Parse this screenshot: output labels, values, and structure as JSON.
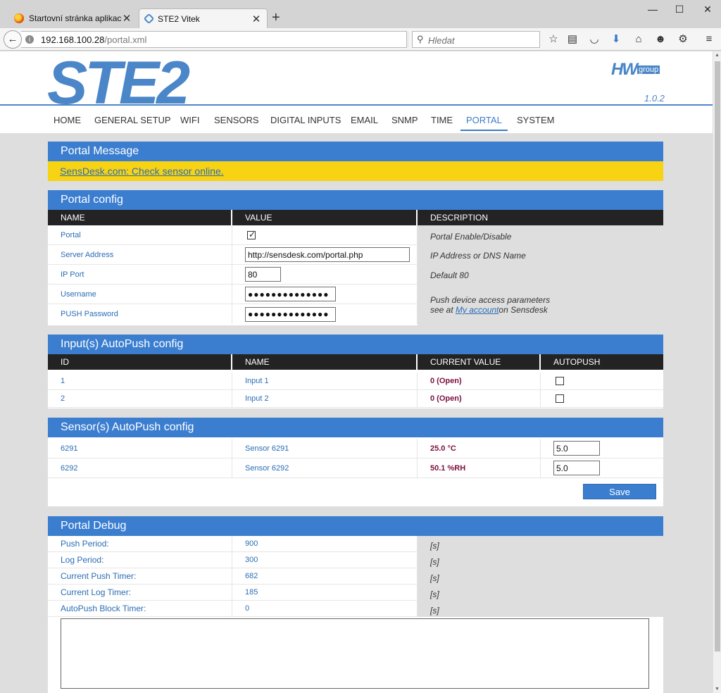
{
  "browser": {
    "tabs": [
      {
        "label": "Startovní stránka aplikace ...",
        "close": "✕"
      },
      {
        "label": "STE2 Vitek",
        "close": "✕"
      }
    ],
    "new_tab": "+",
    "window": {
      "minimize": "—",
      "maximize": "☐",
      "close": "✕"
    },
    "url_host": "192.168.100.28",
    "url_path": "/portal.xml",
    "search_placeholder": "Hledat",
    "icons": [
      "back-arrow-icon",
      "info-icon",
      "reload-icon",
      "search-icon",
      "star-icon",
      "reading-list-icon",
      "pocket-icon",
      "download-icon",
      "home-icon",
      "smiley-icon",
      "gear-icon",
      "hamburger-menu-icon"
    ]
  },
  "header": {
    "logo": "STE2",
    "brand_hw": "HW",
    "brand_group": "group",
    "version": "1.0.2"
  },
  "menu": [
    "HOME",
    "GENERAL SETUP",
    "WIFI",
    "SENSORS",
    "DIGITAL INPUTS",
    "EMAIL",
    "SNMP",
    "TIME",
    "PORTAL",
    "SYSTEM"
  ],
  "menu_active": "PORTAL",
  "portal_message": {
    "title": "Portal Message",
    "link": "SensDesk.com: Check sensor online.",
    "bg_color": "#f7d314"
  },
  "portal_config": {
    "title": "Portal config",
    "headers": [
      "NAME",
      "VALUE",
      "DESCRIPTION"
    ],
    "rows": {
      "portal": {
        "label": "Portal",
        "checked": true,
        "desc": "Portal Enable/Disable"
      },
      "server": {
        "label": "Server Address",
        "value": "http://sensdesk.com/portal.php",
        "desc": "IP Address or DNS Name"
      },
      "port": {
        "label": "IP Port",
        "value": "80",
        "desc": "Default 80"
      },
      "username": {
        "label": "Username",
        "value": "●●●●●●●●●●●●●●"
      },
      "password": {
        "label": "PUSH Password",
        "value": "●●●●●●●●●●●●●●"
      }
    },
    "access_desc_1": "Push device access parameters",
    "access_desc_2a": "see at ",
    "access_link": "My account",
    "access_desc_2b": "on Sensdesk"
  },
  "inputs_autopush": {
    "title": "Input(s) AutoPush config",
    "headers": [
      "ID",
      "NAME",
      "CURRENT VALUE",
      "AUTOPUSH"
    ],
    "rows": [
      {
        "id": "1",
        "name": "Input 1",
        "value": "0 (Open)",
        "autopush": false
      },
      {
        "id": "2",
        "name": "Input 2",
        "value": "0 (Open)",
        "autopush": false
      }
    ]
  },
  "sensors_autopush": {
    "title": "Sensor(s) AutoPush config",
    "rows": [
      {
        "id": "6291",
        "name": "Sensor 6291",
        "value": "25.0 °C",
        "delta": "5.0"
      },
      {
        "id": "6292",
        "name": "Sensor 6292",
        "value": "50.1 %RH",
        "delta": "5.0"
      }
    ],
    "save_label": "Save"
  },
  "portal_debug": {
    "title": "Portal Debug",
    "rows": [
      {
        "label": "Push Period:",
        "value": "900",
        "unit": "[s]"
      },
      {
        "label": "Log Period:",
        "value": "300",
        "unit": "[s]"
      },
      {
        "label": "Current Push Timer:",
        "value": "682",
        "unit": "[s]"
      },
      {
        "label": "Current Log Timer:",
        "value": "185",
        "unit": "[s]"
      },
      {
        "label": "AutoPush Block Timer:",
        "value": "0",
        "unit": "[s]"
      }
    ],
    "log_text": ""
  },
  "colors": {
    "accent": "#3b7ed0",
    "header_dark": "#232323",
    "logo_blue": "#4a86c8",
    "value_maroon": "#7a1040"
  }
}
